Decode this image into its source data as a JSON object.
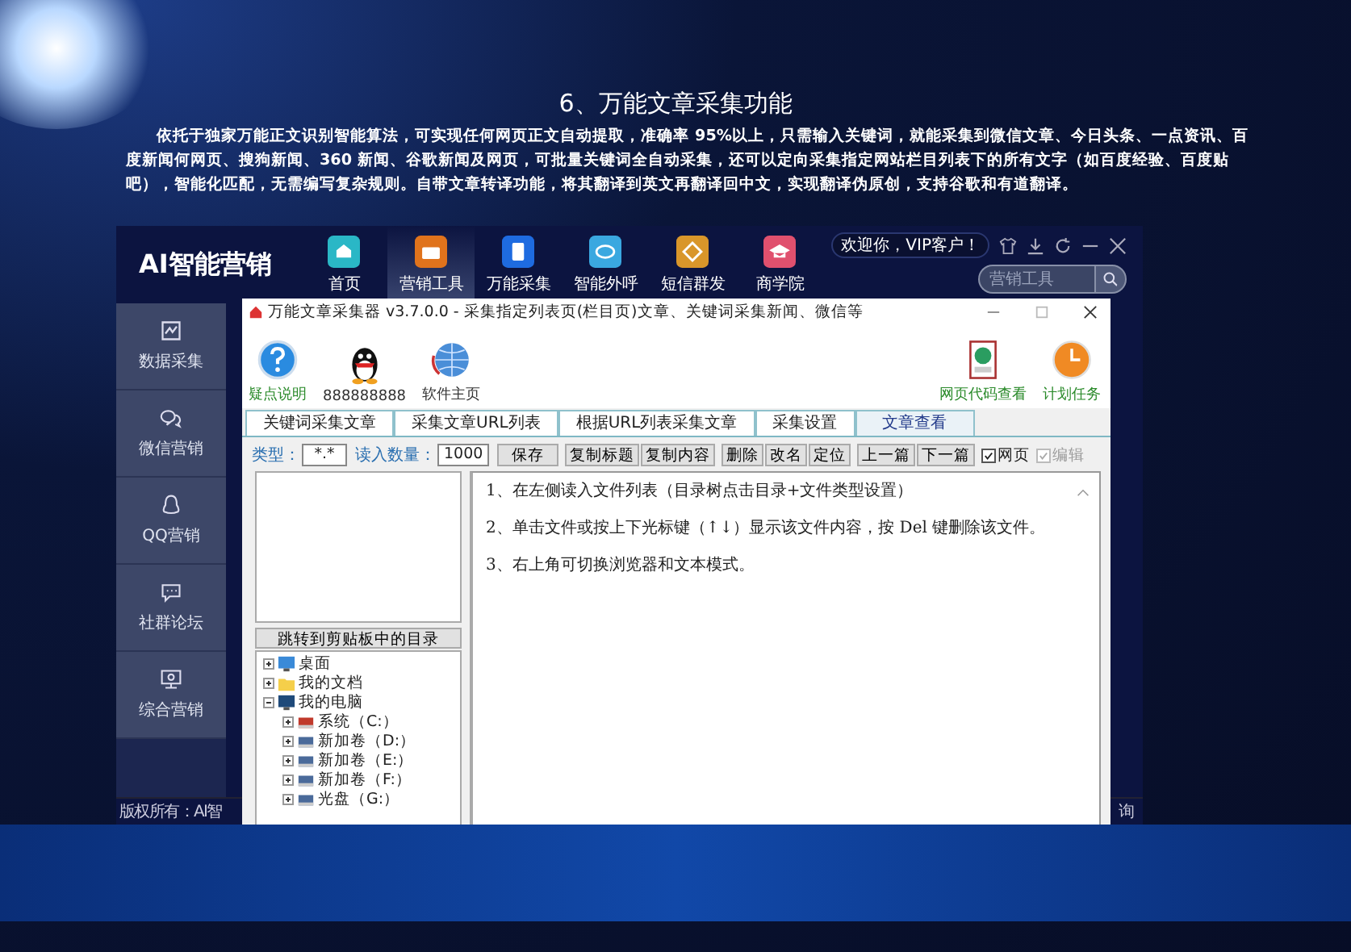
{
  "heading": "6、万能文章采集功能",
  "intro": "依托于独家万能正文识别智能算法，可实现任何网页正文自动提取，准确率 95%以上，只需输入关键词，就能采集到微信文章、今日头条、一点资讯、百度新闻何网页、搜狗新闻、360 新闻、谷歌新闻及网页，可批量关键词全自动采集，还可以定向采集指定网站栏目列表下的所有文字（如百度经验、百度贴吧），智能化匹配，无需编写复杂规则。自带文章转译功能，将其翻译到英文再翻译回中文，实现翻译伪原创，支持谷歌和有道翻译。",
  "app": {
    "logo": "AI智能营销",
    "nav": [
      {
        "label": "首页",
        "selected": false,
        "color": "#2ab7c6"
      },
      {
        "label": "营销工具",
        "selected": true,
        "color": "#e0731c"
      },
      {
        "label": "万能采集",
        "selected": false,
        "color": "#1e6be0"
      },
      {
        "label": "智能外呼",
        "selected": false,
        "color": "#3aa8e0"
      },
      {
        "label": "短信群发",
        "selected": false,
        "color": "#d9962a"
      },
      {
        "label": "商学院",
        "selected": false,
        "color": "#e0506e"
      }
    ],
    "greeting": "欢迎你，VIP客户！",
    "search": {
      "placeholder": "营销工具"
    },
    "sidebar": [
      {
        "label": "数据采集"
      },
      {
        "label": "微信营销"
      },
      {
        "label": "QQ营销"
      },
      {
        "label": "社群论坛"
      },
      {
        "label": "综合营销"
      }
    ],
    "footer": {
      "copyright": "版权所有：AI智",
      "right": "询"
    }
  },
  "window": {
    "title": "万能文章采集器 v3.7.0.0 - 采集指定列表页(栏目页)文章、关键词采集新闻、微信等",
    "toolbar_left": [
      {
        "label": "疑点说明"
      },
      {
        "label": "888888888"
      },
      {
        "label": "软件主页"
      }
    ],
    "toolbar_right": [
      {
        "label": "网页代码查看"
      },
      {
        "label": "计划任务"
      }
    ],
    "tabs": [
      {
        "label": "关键词采集文章",
        "selected": false
      },
      {
        "label": "采集文章URL列表",
        "selected": false
      },
      {
        "label": "根据URL列表采集文章",
        "selected": false
      },
      {
        "label": "采集设置",
        "selected": false
      },
      {
        "label": "文章查看",
        "selected": true
      }
    ],
    "type_label": "类型：",
    "type_value": "*.*",
    "count_label": "读入数量：",
    "count_value": "1000",
    "buttons": [
      "保存",
      "复制标题",
      "复制内容",
      "删除",
      "改名",
      "定位",
      "上一篇",
      "下一篇"
    ],
    "checks": [
      {
        "label": "网页",
        "checked": true,
        "disabled": false
      },
      {
        "label": "编辑",
        "checked": true,
        "disabled": true
      }
    ],
    "jump_button": "跳转到剪贴板中的目录",
    "tree": [
      {
        "label": "桌面",
        "expanded": false
      },
      {
        "label": "我的文档",
        "expanded": false
      },
      {
        "label": "我的电脑",
        "expanded": true,
        "children": [
          {
            "label": "系统（C:）",
            "expanded": false
          },
          {
            "label": "新加卷（D:）",
            "expanded": false
          },
          {
            "label": "新加卷（E:）",
            "expanded": false
          },
          {
            "label": "新加卷（F:）",
            "expanded": false
          },
          {
            "label": "光盘（G:）",
            "expanded": false
          }
        ]
      }
    ],
    "content": [
      "1、在左侧读入文件列表（目录树点击目录+文件类型设置）",
      "2、单击文件或按上下光标键（↑↓）显示该文件内容，按 Del 键删除该文件。",
      "3、右上角可切换浏览器和文本模式。"
    ]
  }
}
